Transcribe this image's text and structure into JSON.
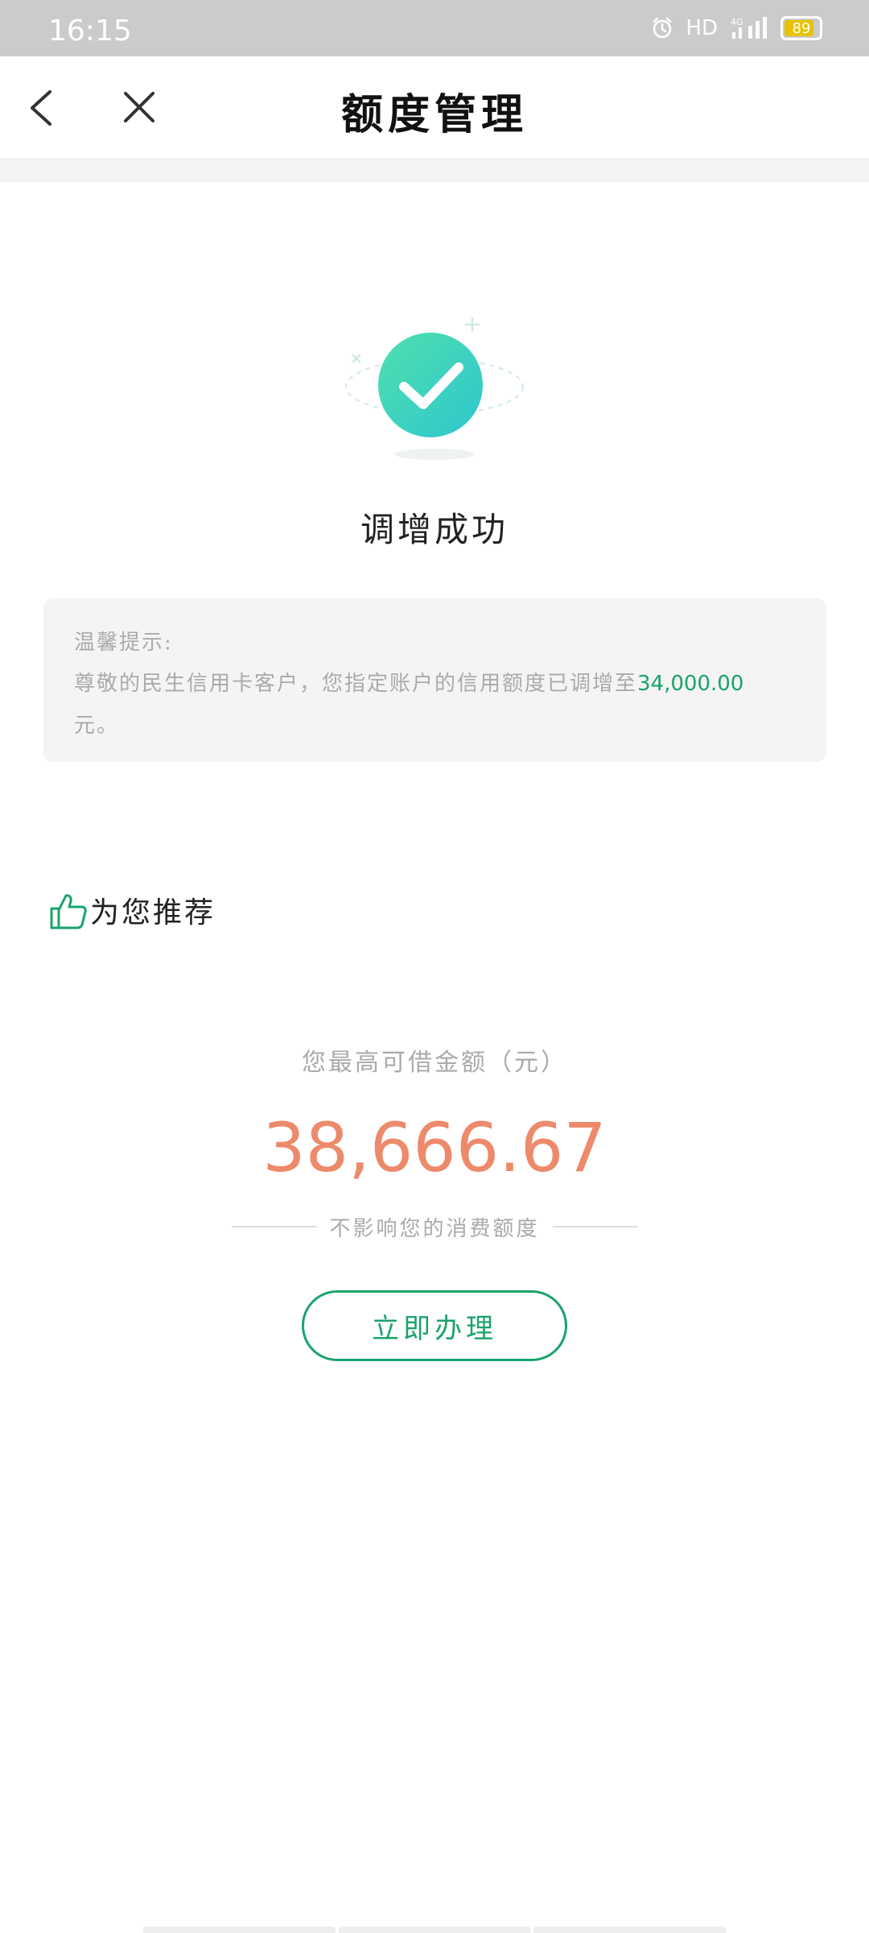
{
  "status_bar": {
    "time": "16:15",
    "hd_label": "HD",
    "network_label": "4G",
    "battery_level": "89"
  },
  "nav": {
    "title": "额度管理",
    "back_icon": "chevron-left-icon",
    "close_icon": "close-icon"
  },
  "result": {
    "icon": "success-check-icon",
    "title": "调增成功"
  },
  "tip": {
    "label": "温馨提示:",
    "text_before": "尊敬的民生信用卡客户，您指定账户的信用额度已调增至",
    "amount": "34,000.00",
    "text_after": "元。"
  },
  "recommend": {
    "icon": "thumbs-up-icon",
    "title": "为您推荐"
  },
  "loan": {
    "label": "您最高可借金额（元）",
    "amount": "38,666.67",
    "note": "不影响您的消费额度",
    "button_label": "立即办理"
  },
  "colors": {
    "brand_green": "#1aa36b",
    "amount_orange": "#ec8a6b",
    "success_teal": "#3fd2b0",
    "status_bar_gray": "#cbcbcb"
  }
}
